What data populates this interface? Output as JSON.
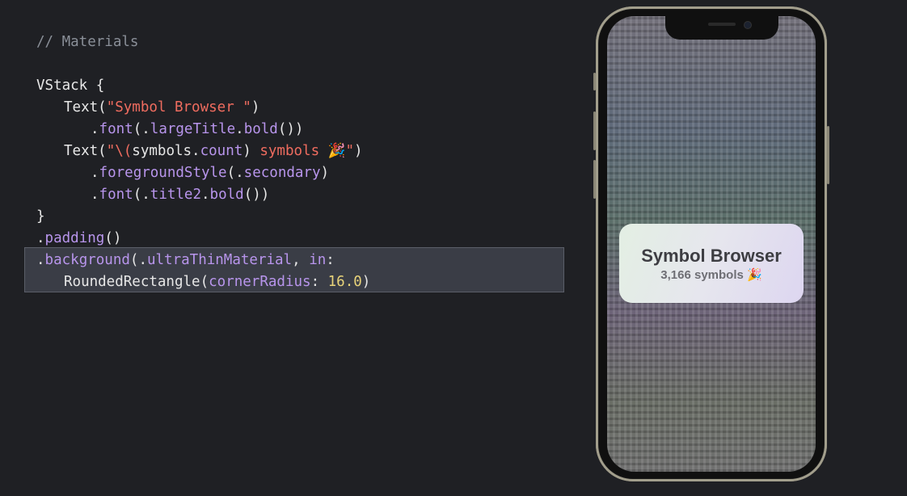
{
  "code": {
    "comment": "// Materials",
    "l_vstack": "VStack {",
    "l_text1_a": "Text(",
    "l_text1_str": "\"Symbol Browser \"",
    "l_text1_b": ")",
    "l_font1_dot": ".",
    "l_font1_fn": "font",
    "l_font1_open": "(.",
    "l_font1_title": "largeTitle",
    "l_font1_dot2": ".",
    "l_font1_bold": "bold",
    "l_font1_close": "())",
    "l_text2_a": "Text(",
    "l_text2_q": "\"\\(",
    "l_text2_sym": "symbols.",
    "l_text2_count": "count",
    "l_text2_paren": ")",
    "l_text2_str": " symbols 🎉",
    "l_text2_q2": "\"",
    "l_text2_close": ")",
    "l_fg_dot": ".",
    "l_fg_fn": "foregroundStyle",
    "l_fg_open": "(.",
    "l_fg_val": "secondary",
    "l_fg_close": ")",
    "l_font2_dot": ".",
    "l_font2_fn": "font",
    "l_font2_open": "(.",
    "l_font2_title": "title2",
    "l_font2_dot2": ".",
    "l_font2_bold": "bold",
    "l_font2_close": "())",
    "l_brace": "}",
    "l_pad_dot": ".",
    "l_pad_fn": "padding",
    "l_pad_close": "()",
    "l_bg_dot": ".",
    "l_bg_fn": "background",
    "l_bg_open": "(.",
    "l_bg_mat": "ultraThinMaterial",
    "l_bg_comma": ", ",
    "l_bg_in": "in",
    "l_bg_colon": ":",
    "l_rr_type": "RoundedRectangle(",
    "l_rr_arg": "cornerRadius",
    "l_rr_colon": ": ",
    "l_rr_num": "16.0",
    "l_rr_close": ")"
  },
  "preview": {
    "title": "Symbol Browser",
    "subtitle": "3,166 symbols 🎉"
  },
  "colors": {
    "background": "#1f2024",
    "string": "#ef6c5f",
    "member": "#b895ec",
    "number": "#e8d37a",
    "comment": "#8a8f98"
  }
}
